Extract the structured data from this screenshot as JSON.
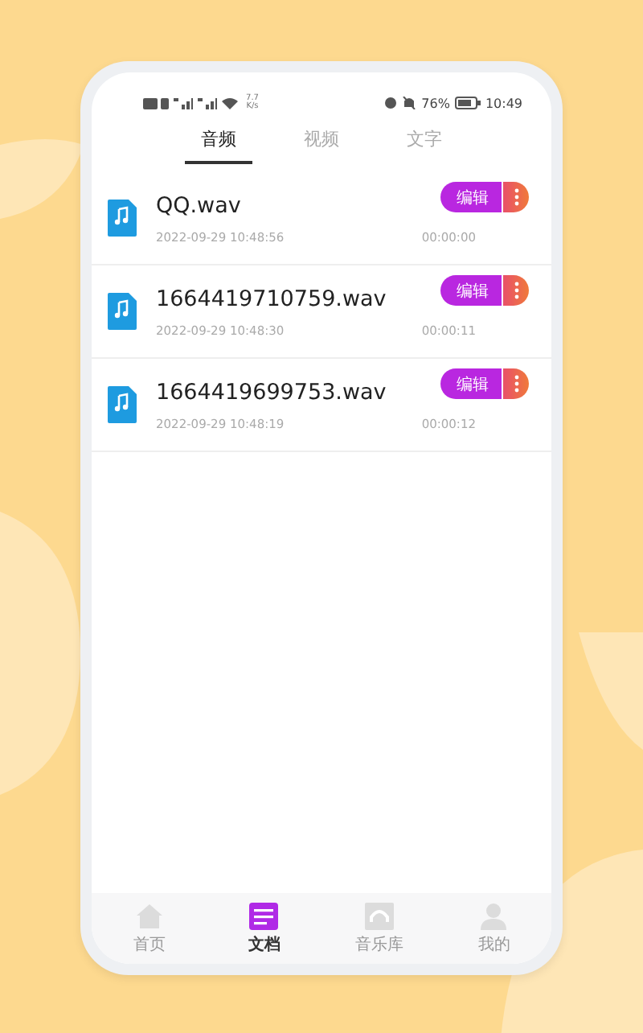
{
  "status_bar": {
    "network_speed": "7.7 K/s",
    "battery": "76%",
    "time": "10:49"
  },
  "tabs": [
    {
      "label": "音频",
      "selected": true
    },
    {
      "label": "视频",
      "selected": false
    },
    {
      "label": "文字",
      "selected": false
    }
  ],
  "files": [
    {
      "name": "QQ.wav",
      "date": "2022-09-29 10:48:56",
      "duration": "00:00:00",
      "action": "编辑"
    },
    {
      "name": "1664419710759.wav",
      "date": "2022-09-29 10:48:30",
      "duration": "00:00:11",
      "action": "编辑"
    },
    {
      "name": "1664419699753.wav",
      "date": "2022-09-29 10:48:19",
      "duration": "00:00:12",
      "action": "编辑"
    }
  ],
  "bottom_nav": [
    {
      "label": "首页",
      "kind": "home",
      "selected": false
    },
    {
      "label": "文档",
      "kind": "document",
      "selected": true
    },
    {
      "label": "音乐库",
      "kind": "music",
      "selected": false
    },
    {
      "label": "我的",
      "kind": "profile",
      "selected": false
    }
  ]
}
